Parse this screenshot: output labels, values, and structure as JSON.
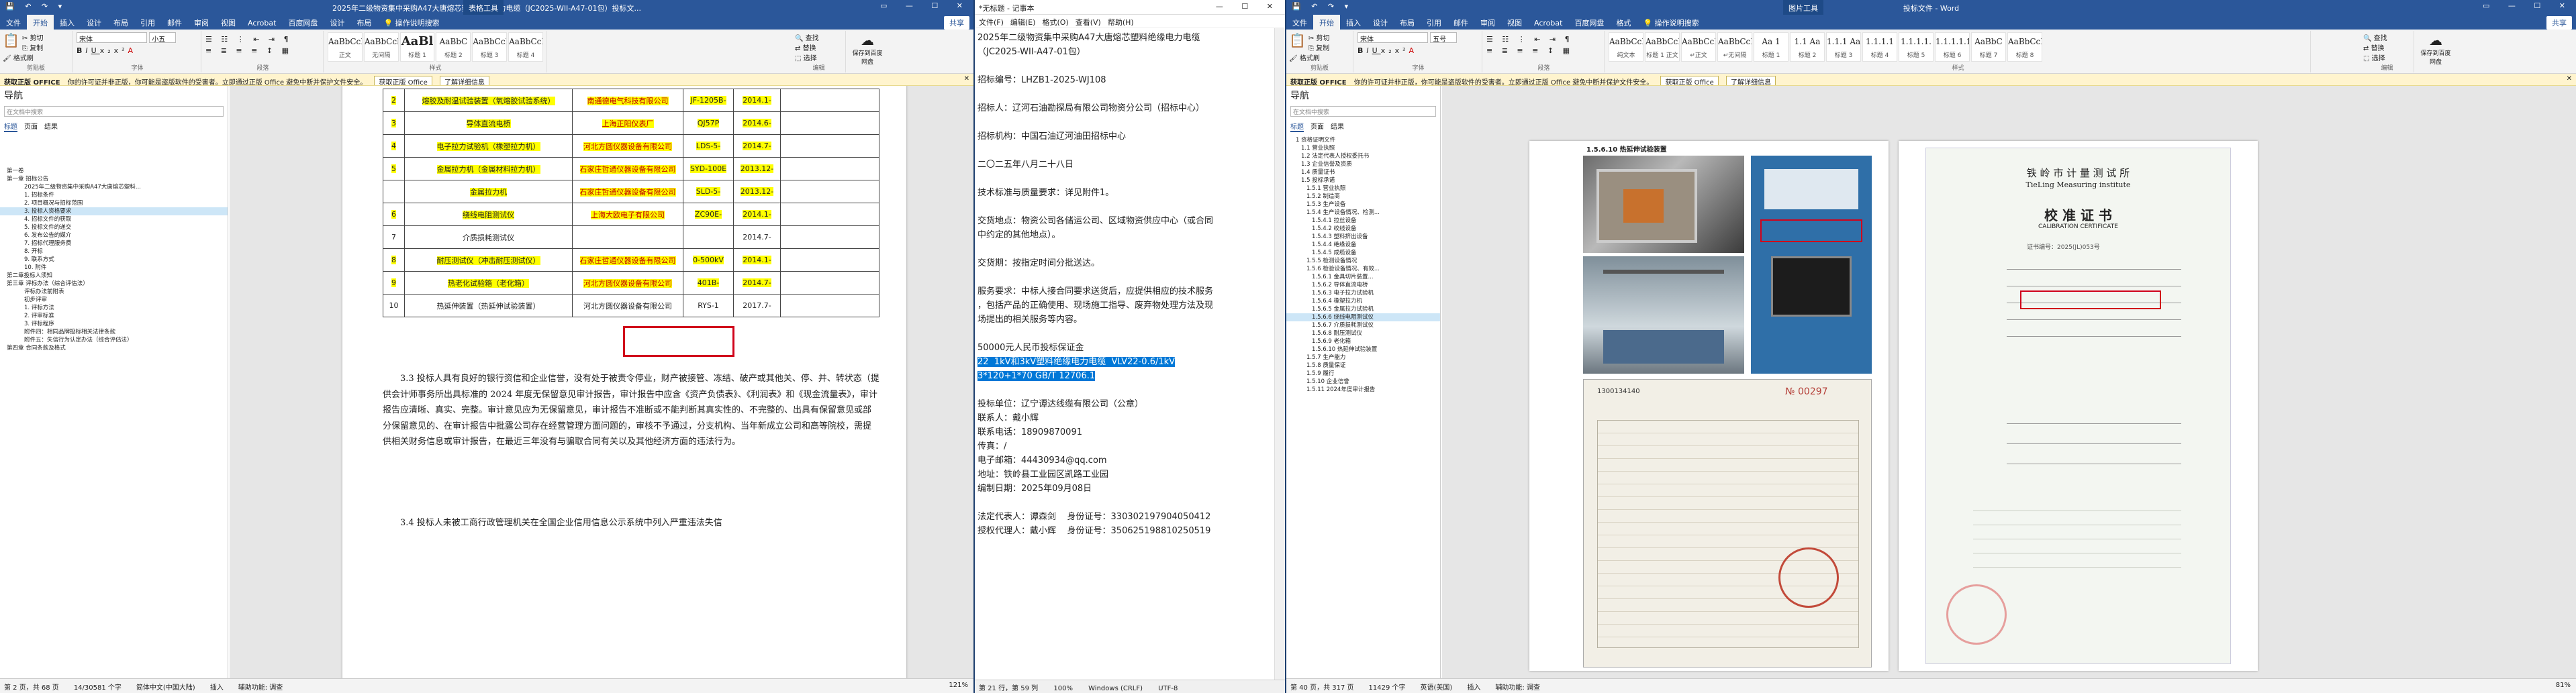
{
  "word_left": {
    "title": "2025年二级物资集中采购A47大唐熔芯塑料绝缘电力电缆（JC2025-WII-A47-01包）投标文...",
    "context_tab": "表格工具",
    "tabs": [
      "文件",
      "开始",
      "插入",
      "设计",
      "布局",
      "引用",
      "邮件",
      "审阅",
      "视图",
      "Acrobat",
      "百度网盘",
      "设计",
      "布局"
    ],
    "active_tab": "开始",
    "search": "操作说明搜索",
    "share": "共享",
    "clipboard": {
      "paste": "粘贴",
      "cut": "剪切",
      "copy": "复制",
      "painter": "格式刷",
      "label": "剪贴板"
    },
    "font": {
      "name": "宋体",
      "size": "小五",
      "label": "字体"
    },
    "paragraph_label": "段落",
    "styles": [
      {
        "sample": "AaBbCcDd",
        "name": "正文",
        "big": false
      },
      {
        "sample": "AaBbCcDd",
        "name": "无间隔",
        "big": false
      },
      {
        "sample": "AaBl",
        "name": "标题 1",
        "big": true
      },
      {
        "sample": "AaBbC",
        "name": "标题 2",
        "big": false
      },
      {
        "sample": "AaBbCcE",
        "name": "标题 3",
        "big": false
      },
      {
        "sample": "AaBbCcI",
        "name": "标题 4",
        "big": false
      }
    ],
    "styles_label": "样式",
    "editing": [
      "查找",
      "替换",
      "选择"
    ],
    "editing_label": "编辑",
    "save_baidu": "保存到百度网盘",
    "infobar": {
      "tag": "获取正版 OFFICE",
      "text": "你的许可证并非正版，你可能是盗版软件的受害者。立即通过正版 Office 避免中断并保护文件安全。",
      "btn1": "获取正版 Office",
      "btn2": "了解详细信息"
    },
    "nav": {
      "title": "导航",
      "search": "在文档中搜索",
      "tabs": [
        "标题",
        "页面",
        "结果"
      ],
      "items": [
        "第一卷",
        "第一章  招标公告",
        "2025年二级物资集中采购A47大唐熔芯塑料...",
        "1. 招标条件",
        "2. 项目概况与招标范围",
        "3. 投标人资格要求",
        "4. 招标文件的获取",
        "5. 投标文件的递交",
        "6. 发布公告的媒介",
        "7. 招标代理服务费",
        "8. 开标",
        "9. 联系方式",
        "10. 附件",
        "第二章投标人须知",
        "第三章  评标办法（综合评估法）",
        "评标办法前附表",
        "初步评审",
        "1. 评标方法",
        "2. 评审标准",
        "3. 评标程序",
        "附件四：相同品牌投标相关法律条款",
        "附件五：失信行为认定办法（综合评估法）",
        "第四章  合同条款及格式"
      ],
      "selected": 5
    },
    "table": [
      {
        "no": "2",
        "name": "熔胶及耐温试验装置（氧熔胶试验系统）",
        "mfr": "南通德电气科技有限公司",
        "model": "JF-1205B-",
        "date": "2014.1-"
      },
      {
        "no": "3",
        "name": "导体直流电桥",
        "mfr": "上海正阳仪表厂",
        "model": "QJ57P",
        "date": "2014.6-"
      },
      {
        "no": "4",
        "name": "电子拉力试验机（橡塑拉力机）",
        "mfr": "河北方圆仪器设备有限公司",
        "model": "LDS-5-",
        "date": "2014.7-"
      },
      {
        "no": "5",
        "name": "金属拉力机（金属材料拉力机）",
        "mfr": "石家庄哲通仪器设备有限公司",
        "model": "SYD-100E",
        "date": "2013.12-"
      },
      {
        "no": "",
        "name": "金属拉力机",
        "mfr": "石家庄哲通仪器设备有限公司",
        "model": "SLD-5-",
        "date": "2013.12-"
      },
      {
        "no": "6",
        "name": "绕线电阻测试仪",
        "mfr": "上海大欧电子有限公司",
        "model": "ZC90E-",
        "date": "2014.1-"
      },
      {
        "no": "7",
        "name": "介质损耗测试仪",
        "mfr": "",
        "model": "",
        "date": "2014.7-"
      },
      {
        "no": "8",
        "name": "耐压测试仪（冲击耐压测试仪）",
        "mfr": "石家庄哲通仪器设备有限公司",
        "model": "0-500kV",
        "date": "2014.1-"
      },
      {
        "no": "9",
        "name": "热老化试验箱（老化箱）",
        "mfr": "河北方圆仪器设备有限公司",
        "model": "401B-",
        "date": "2014.7-"
      },
      {
        "no": "10",
        "name": "热延伸装置（热延伸试验装置）",
        "mfr": "河北方圆仪器设备有限公司",
        "model": "RYS-1",
        "date": "2017.7-"
      }
    ],
    "para1": "3.3 投标人具有良好的银行资信和企业信誉，没有处于被责令停业，财产被接管、冻结、破产或其他关、停、并、转状态（提供会计师事务所出具标准的 2024 年度无保留意见审计报告，审计报告中应含《资产负债表》、《利润表》和《现金流量表》，审计报告应清晰、真实、完整。审计意见应为无保留意见，审计报告不准断或不能判断其真实性的、不完整的、出具有保留意见或部分保留意见的、在审计报告中批露公司存在经营管理方面问题的，审核不予通过，分支机构、当年新成立公司和高等院校，需提供相关财务信息或审计报告，在最近三年没有与骗取合同有关以及其他经济方面的违法行为。",
    "para2": "3.4 投标人未被工商行政管理机关在全国企业信用信息公示系统中列入严重违法失信",
    "status": [
      "第 2 页，共 68 页",
      "14/30581 个字",
      "简体中文(中国大陆)",
      "插入",
      "辅助功能: 调查"
    ],
    "zoom": "121%"
  },
  "notepad": {
    "title": "*无标题 - 记事本",
    "menu": [
      "文件(F)",
      "编辑(E)",
      "格式(O)",
      "查看(V)",
      "帮助(H)"
    ],
    "lines_before": [
      "2025年二级物资集中采购A47大唐熔芯塑料绝缘电力电缆",
      "（JC2025-WII-A47-01包）",
      "",
      "招标编号：LHZB1-2025-WJ108",
      "",
      "招标人：辽河石油勘探局有限公司物资分公司（招标中心）",
      "",
      "招标机构：中国石油辽河油田招标中心",
      "",
      "二〇二五年八月二十八日",
      "",
      "技术标准与质量要求：详见附件1。",
      "",
      "交货地点：物资公司各储运公司、区域物资供应中心（或合同",
      "中约定的其他地点）。",
      "",
      "交货期：按指定时间分批送达。",
      "",
      "服务要求：中标人接合同要求送货后，应提供相应的技术服务",
      "，包括产品的正确使用、现场施工指导、废弃物处理方法及现",
      "场提出的相关服务等内容。",
      "",
      "50000元人民币投标保证金",
      ""
    ],
    "selected": [
      "22  1kV和3kV塑料绝缘电力电缆  VLV22-0.6/1kV",
      "3*120+1*70 GB/T 12706.1"
    ],
    "lines_after": [
      "",
      "投标单位：辽宁谭达线缆有限公司（公章）",
      "联系人：戴小辉",
      "联系电话：18909870091",
      "传真：/",
      "电子邮箱：44430934@qq.com",
      "地址：铁岭县工业园区凯路工业园",
      "编制日期：2025年09月08日",
      "",
      "法定代表人：谭森剑    身份证号：330302197904050412",
      "授权代理人：戴小辉    身份证号：350625198810250519"
    ],
    "status": {
      "pos": "第 21 行，第 59 列",
      "zoom": "100%",
      "eol": "Windows (CRLF)",
      "enc": "UTF-8"
    }
  },
  "word_right": {
    "title": "投标文件 - Word",
    "context_tab": "图片工具",
    "tabs": [
      "文件",
      "开始",
      "插入",
      "设计",
      "布局",
      "引用",
      "邮件",
      "审阅",
      "视图",
      "Acrobat",
      "百度网盘",
      "格式"
    ],
    "active_tab": "开始",
    "search": "操作说明搜索",
    "share": "共享",
    "font": {
      "name": "宋体",
      "size": "五号"
    },
    "styles": [
      {
        "sample": "AaBbCcDd",
        "name": "纯文本"
      },
      {
        "sample": "AaBbCcDd",
        "name": "标题 1 正文"
      },
      {
        "sample": "AaBbCcDd",
        "name": "↵正文"
      },
      {
        "sample": "AaBbCcDd",
        "name": "↵无间隔"
      },
      {
        "sample": "Aa 1",
        "name": "标题 1"
      },
      {
        "sample": "1.1 Aa",
        "name": "标题 2"
      },
      {
        "sample": "1.1.1 Aa",
        "name": "标题 3"
      },
      {
        "sample": "1.1.1.1",
        "name": "标题 4"
      },
      {
        "sample": "1.1.1.1.",
        "name": "标题 5"
      },
      {
        "sample": "1.1.1.1.1",
        "name": "标题 6"
      },
      {
        "sample": "AaBbC",
        "name": "标题 7"
      },
      {
        "sample": "AaBbCcDd",
        "name": "标题 8"
      }
    ],
    "infobar": {
      "tag": "获取正版 OFFICE",
      "text": "你的许可证并非正版，你可能是盗版软件的受害者。立即通过正版 Office 避免中断并保护文件安全。",
      "btn1": "获取正版 Office",
      "btn2": "了解详细信息"
    },
    "nav": {
      "title": "导航",
      "search": "在文档中搜索",
      "tabs": [
        "标题",
        "页面",
        "结果"
      ],
      "items": [
        "1 资格证明文件",
        "1.1 营业执照",
        "1.2 法定代表人授权委托书",
        "1.3 企业信誉及资质",
        "1.4 质量证书",
        "1.5 投标承诺",
        "1.5.1 营业执照",
        "1.5.2 制造商",
        "1.5.3 生产设备",
        "1.5.4 生产设备情况、检测...",
        "1.5.4.1 拉丝设备",
        "1.5.4.2 绞线设备",
        "1.5.4.3 塑料挤出设备",
        "1.5.4.4 绝缘设备",
        "1.5.4.5 成缆设备",
        "1.5.5 检测设备情况",
        "1.5.6 检验设备情况、有效...",
        "1.5.6.1 金具切片装置...",
        "1.5.6.2 导体直流电桥",
        "1.5.6.3 电子拉力试验机",
        "1.5.6.4 橡塑拉力机",
        "1.5.6.5 金属拉力试验机",
        "1.5.6.6 绕线电阻测试仪",
        "1.5.6.7 介质损耗测试仪",
        "1.5.6.8 耐压测试仪",
        "1.5.6.9 老化箱",
        "1.5.6.10 热延伸试验装置",
        "1.5.7 生产能力",
        "1.5.8 质量保证",
        "1.5.9 履行",
        "1.5.10 企业信誉",
        "1.5.11 2024年度审计报告"
      ],
      "selected": 22
    },
    "photo_caption": "1.5.6.10  热延伸试验装置",
    "cert": {
      "org_cn": "铁 岭 市 计 量 测 试 所",
      "org_en": "TieLing  Measuring  institute",
      "title_cn": "校  准  证  书",
      "title_en": "CALIBRATION   CERTIFICATE",
      "no": "证书编号：2025(JL)053号"
    },
    "status": [
      "第 40 页，共 317 页",
      "11429 个字",
      "英语(美国)",
      "插入",
      "辅助功能: 调查"
    ],
    "zoom": "81%"
  }
}
